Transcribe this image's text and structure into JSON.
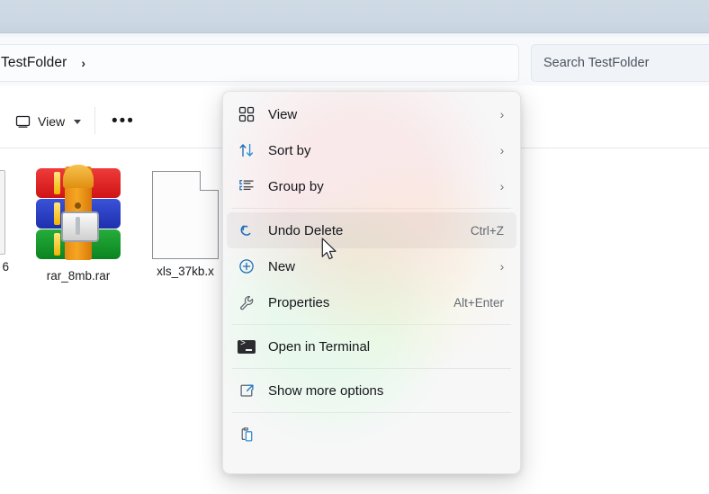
{
  "window": {
    "breadcrumb": "TestFolder",
    "breadcrumb_separator": "›",
    "search_placeholder": "Search TestFolder"
  },
  "toolbar": {
    "view_label": "View",
    "view_icon": "monitor-icon",
    "more_label": "•••",
    "more_icon": "ellipsis-icon"
  },
  "files": [
    {
      "name": "rar_8mb.rar",
      "icon": "winrar-archive-icon"
    },
    {
      "name": "xls_37kb.x",
      "icon": "blank-document-icon"
    }
  ],
  "edge_file": {
    "name": "6",
    "icon": "clipped-file-icon"
  },
  "context_menu": {
    "groups": [
      {
        "items": [
          {
            "label": "View",
            "icon": "grid-view-icon",
            "accel": "",
            "chevron": "›",
            "selected": false
          },
          {
            "label": "Sort by",
            "icon": "sort-icon",
            "accel": "",
            "chevron": "›",
            "selected": false
          },
          {
            "label": "Group by",
            "icon": "group-by-icon",
            "accel": "",
            "chevron": "›",
            "selected": false
          }
        ]
      },
      {
        "items": [
          {
            "label": "Undo Delete",
            "icon": "undo-icon",
            "accel": "Ctrl+Z",
            "chevron": "",
            "selected": true
          },
          {
            "label": "New",
            "icon": "plus-circle-icon",
            "accel": "",
            "chevron": "›",
            "selected": false
          },
          {
            "label": "Properties",
            "icon": "wrench-icon",
            "accel": "Alt+Enter",
            "chevron": "",
            "selected": false
          }
        ]
      },
      {
        "items": [
          {
            "label": "Open in Terminal",
            "icon": "terminal-icon",
            "accel": "",
            "chevron": "",
            "selected": false
          }
        ]
      },
      {
        "items": [
          {
            "label": "Show more options",
            "icon": "show-more-options-icon",
            "accel": "",
            "chevron": "",
            "selected": false
          }
        ]
      },
      {
        "items": [
          {
            "label": "",
            "icon": "paste-icon",
            "accel": "",
            "chevron": "",
            "selected": false
          }
        ]
      }
    ]
  },
  "colors": {
    "accent_blue": "#1e6fbf",
    "chrome": "#ccd8e3",
    "menu_bg": "#f7f7f8",
    "selected_row": "rgba(0,0,0,.045)"
  },
  "cursor": {
    "type": "arrow-pointer"
  }
}
